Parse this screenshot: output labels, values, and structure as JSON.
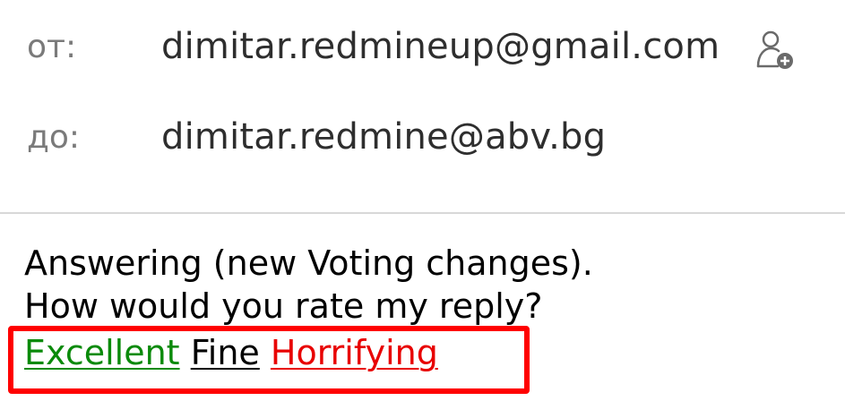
{
  "header": {
    "from_label": "от:",
    "from_value": "dimitar.redmineup@gmail.com",
    "to_label": "до:",
    "to_value": "dimitar.redmine@abv.bg",
    "add_contact_icon": "add-contact-icon"
  },
  "message": {
    "line1": "Answering (new Voting changes).",
    "line2": "How would you rate my reply?"
  },
  "voting": {
    "excellent": "Excellent",
    "fine": "Fine",
    "horrifying": "Horrifying",
    "colors": {
      "excellent": "#0a8a0a",
      "fine": "#000000",
      "horrifying": "#e80000",
      "highlight_box": "#ff0000"
    }
  }
}
